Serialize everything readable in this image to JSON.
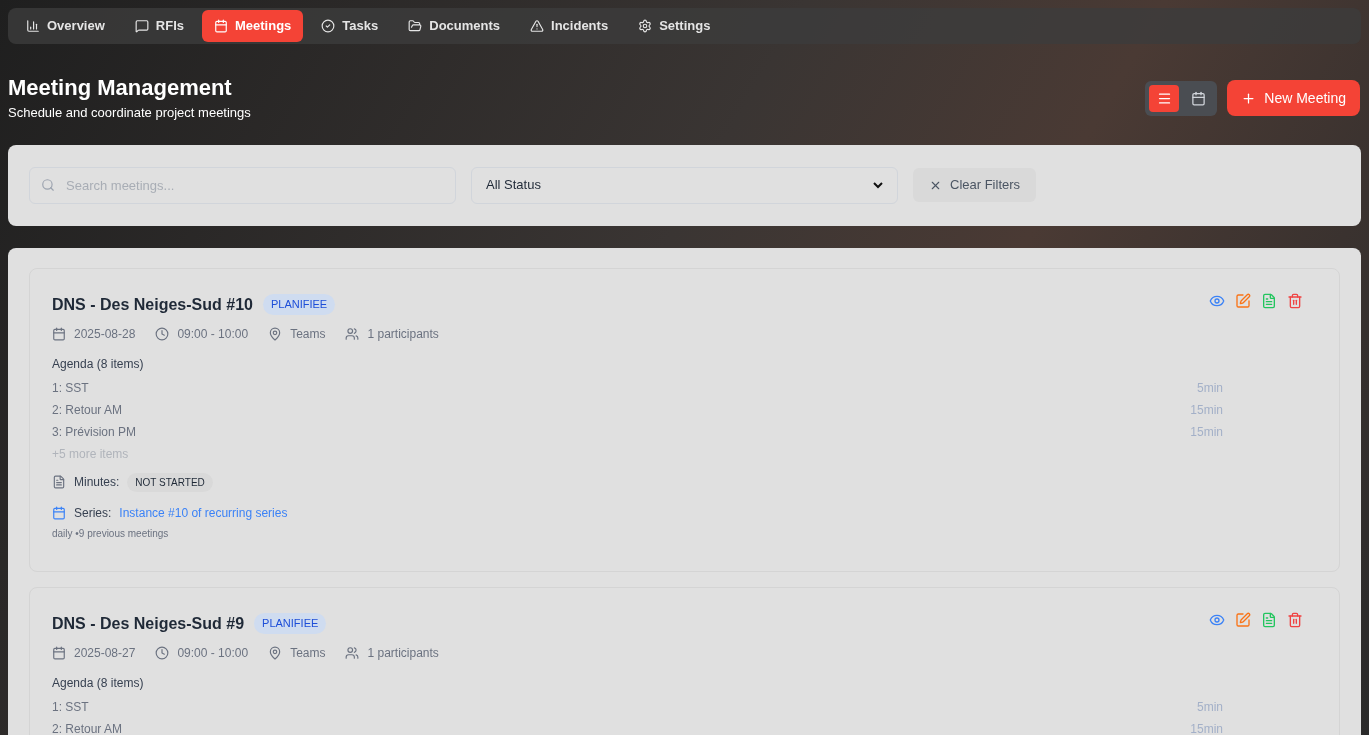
{
  "nav": [
    {
      "kind": "chart",
      "label": "Overview",
      "selected": false
    },
    {
      "kind": "message",
      "label": "RFIs",
      "selected": false
    },
    {
      "kind": "calendar",
      "label": "Meetings",
      "selected": true
    },
    {
      "kind": "check",
      "label": "Tasks",
      "selected": false
    },
    {
      "kind": "folder",
      "label": "Documents",
      "selected": false
    },
    {
      "kind": "alert",
      "label": "Incidents",
      "selected": false
    },
    {
      "kind": "gear",
      "label": "Settings",
      "selected": false
    }
  ],
  "header": {
    "title": "Meeting Management",
    "subtitle": "Schedule and coordinate project meetings"
  },
  "view_toggle": [
    {
      "kind": "list",
      "selected": true
    },
    {
      "kind": "calendar",
      "selected": false
    }
  ],
  "new_button": "New Meeting",
  "filters": {
    "search": {
      "placeholder": "Search meetings..."
    },
    "status": "All Status",
    "clear": "Clear Filters"
  },
  "meetings": [
    {
      "title": "DNS - Des Neiges-Sud #10",
      "status": "PLANIFIEE",
      "date": "2025-08-28",
      "time": "09:00 - 10:00",
      "location": "Teams",
      "participants": "1 participants",
      "agenda_label": "Agenda (8 items)",
      "agenda": [
        {
          "label": "1: SST",
          "duration": "5min"
        },
        {
          "label": "2: Retour AM",
          "duration": "15min"
        },
        {
          "label": "3: Prévision PM",
          "duration": "15min"
        }
      ],
      "more": "+5 more items",
      "minutes_label": "Minutes:",
      "minutes_status": "NOT STARTED",
      "series_label": "Series:",
      "series_link": "Instance #10 of recurring series",
      "series_note": "daily •9 previous meetings"
    },
    {
      "title": "DNS - Des Neiges-Sud #9",
      "status": "PLANIFIEE",
      "date": "2025-08-27",
      "time": "09:00 - 10:00",
      "location": "Teams",
      "participants": "1 participants",
      "agenda_label": "Agenda (8 items)",
      "agenda": [
        {
          "label": "1: SST",
          "duration": "5min"
        },
        {
          "label": "2: Retour AM",
          "duration": "15min"
        }
      ]
    }
  ]
}
